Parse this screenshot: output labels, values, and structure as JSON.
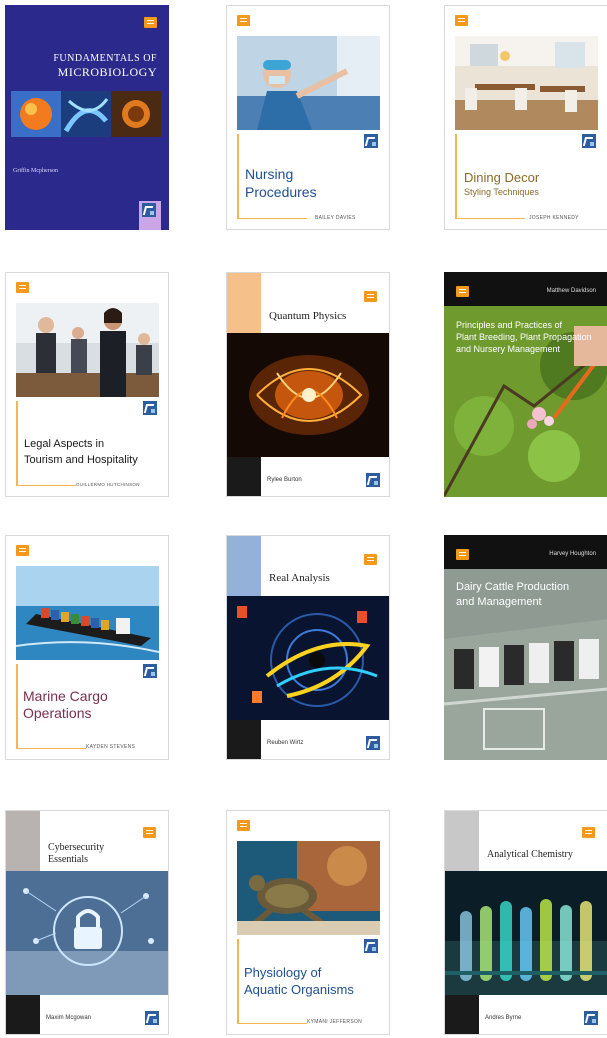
{
  "books": [
    {
      "title_line1": "FUNDAMENTALS OF",
      "title_line2": "MICROBIOLOGY",
      "author": "Griffin Mcpherson"
    },
    {
      "title_line1": "Nursing",
      "title_line2": "Procedures",
      "author": "BAILEY DAVIES"
    },
    {
      "title_line1": "Dining Decor",
      "subtitle": "Styling Techniques",
      "author": "JOSEPH KENNEDY"
    },
    {
      "title_line1": "Legal Aspects in",
      "title_line2": "Tourism and Hospitality",
      "author": "GUILLERMO HUTCHINSON"
    },
    {
      "title_line1": "Quantum Physics",
      "author": "Rylee Burton"
    },
    {
      "title_line1": "Principles and Practices of",
      "title_line2": "Plant Breeding, Plant Propagation",
      "title_line3": "and Nursery Management",
      "author": "Matthew Davidson"
    },
    {
      "title_line1": "Marine Cargo",
      "title_line2": "Operations",
      "author": "KAYDEN STEVENS"
    },
    {
      "title_line1": "Real Analysis",
      "author": "Reuben Wirtz"
    },
    {
      "title_line1": "Dairy Cattle Production",
      "title_line2": "and Management",
      "author": "Harvey Houghton"
    },
    {
      "title_line1": "Cybersecurity",
      "title_line2": "Essentials",
      "author": "Maxim Mcgowan"
    },
    {
      "title_line1": "Physiology of",
      "title_line2": "Aquatic Organisms",
      "author": "KYMANI JEFFERSON"
    },
    {
      "title_line1": "Analytical Chemistry",
      "author": "Andres Byrne"
    }
  ],
  "colors": {
    "accent": "#f39a1d",
    "publisher": "#2d5d9e",
    "line": "#f5b651"
  },
  "icons": {
    "publisher_logo": "publisher-logo-icon",
    "series_logo": "series-logo-icon"
  }
}
